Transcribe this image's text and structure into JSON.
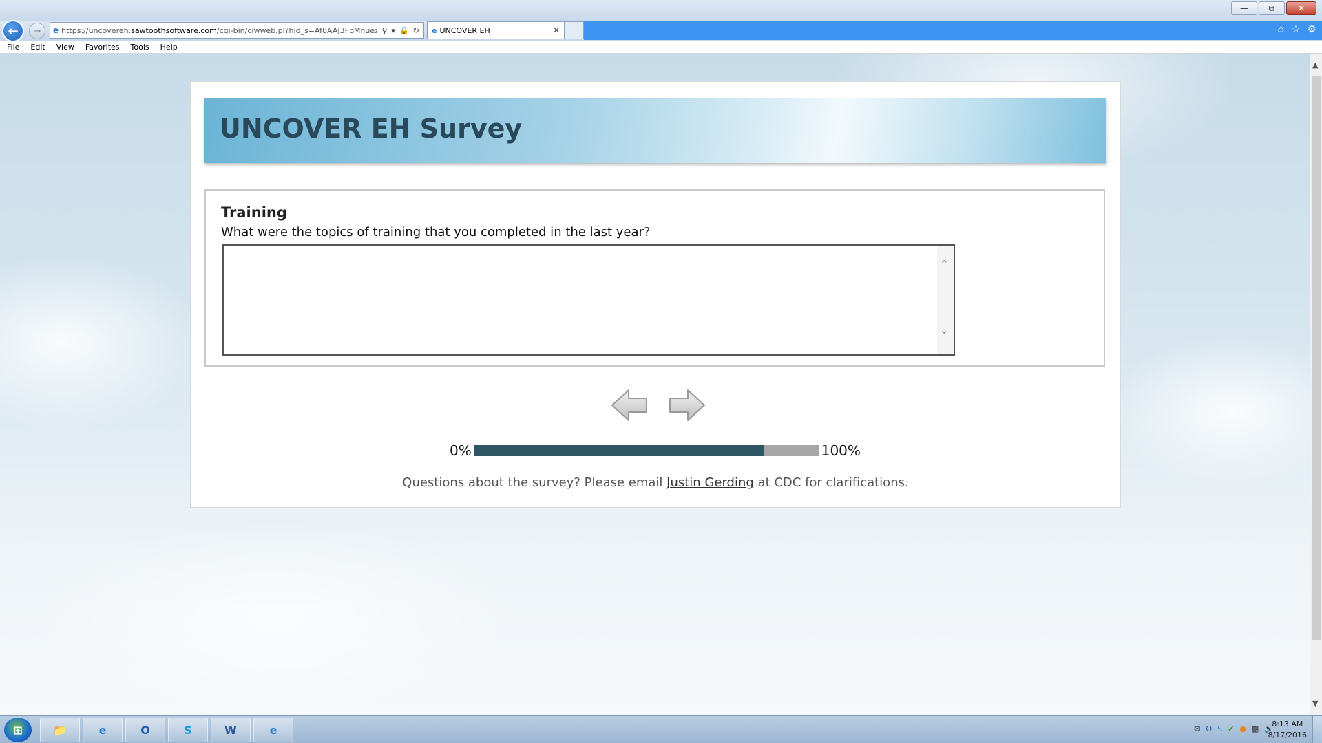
{
  "browser": {
    "address_url_prefix": "https://uncovereh.",
    "address_url_domain": "sawtoothsoftware.com",
    "address_url_path": "/cgi-bin/ciwweb.pl?hid_s=Af8AAJ3FbMnuezYAoCkH",
    "tab_title": "UNCOVER EH",
    "menu": [
      "File",
      "Edit",
      "View",
      "Favorites",
      "Tools",
      "Help"
    ]
  },
  "survey": {
    "banner_title": "UNCOVER EH Survey",
    "question_title": "Training",
    "question_text": "What were the topics of training that you completed in the last year?",
    "answer_value": "",
    "progress_start": "0%",
    "progress_end": "100%",
    "progress_fraction": 0.84,
    "footer_before": "Questions about the survey? Please email ",
    "footer_link": "Justin Gerding",
    "footer_after": " at CDC for clarifications."
  },
  "taskbar": {
    "clock_time": "8:13 AM",
    "clock_date": "8/17/2016"
  },
  "colors": {
    "progress_fill": "#2f5665",
    "progress_track": "#a7a7a7",
    "banner_text": "#29485a",
    "chrome_blue": "#3d95f1"
  }
}
